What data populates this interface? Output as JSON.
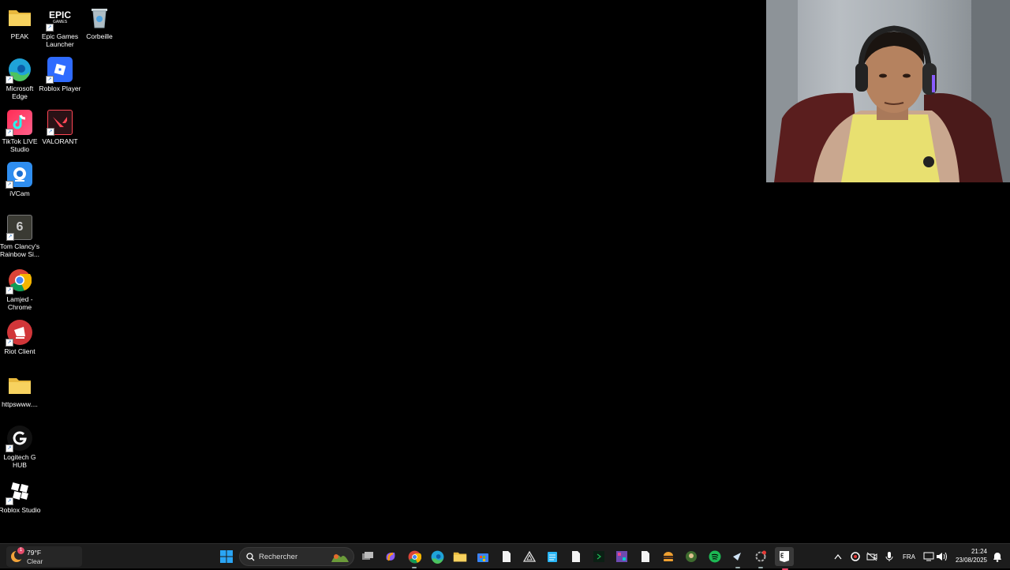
{
  "desktop": {
    "icons": [
      {
        "label": "PEAK",
        "icon": "folder-icon"
      },
      {
        "label": "Epic Games Launcher",
        "icon": "epic-games-icon",
        "logo_text": "EPIC",
        "logo_sub": "GAMES"
      },
      {
        "label": "Corbeille",
        "icon": "recycle-bin-icon"
      },
      {
        "label": "Microsoft Edge",
        "icon": "edge-icon"
      },
      {
        "label": "Roblox Player",
        "icon": "roblox-player-icon"
      },
      {
        "label": "TikTok LIVE Studio",
        "icon": "tiktok-icon"
      },
      {
        "label": "VALORANT",
        "icon": "valorant-icon"
      },
      {
        "label": "iVCam",
        "icon": "ivcam-icon"
      },
      {
        "label": "Tom Clancy's Rainbow Si...",
        "icon": "rainbow-six-icon"
      },
      {
        "label": "Lamjed - Chrome",
        "icon": "chrome-icon"
      },
      {
        "label": "Riot Client",
        "icon": "riot-client-icon"
      },
      {
        "label": "httpswww....",
        "icon": "folder-icon"
      },
      {
        "label": "Logitech G HUB",
        "icon": "logitech-g-hub-icon"
      },
      {
        "label": "Roblox Studio",
        "icon": "roblox-studio-icon"
      }
    ]
  },
  "taskbar": {
    "weather": {
      "temp": "79°F",
      "condition": "Clear",
      "badge": "1"
    },
    "search_placeholder": "Rechercher",
    "tray": {
      "language": "FRA",
      "time": "21:24",
      "date": "23/08/2025"
    }
  },
  "colors": {
    "taskbar_bg": "#1c1c1c",
    "accent": "#0a84ff",
    "spotify": "#1db954"
  }
}
